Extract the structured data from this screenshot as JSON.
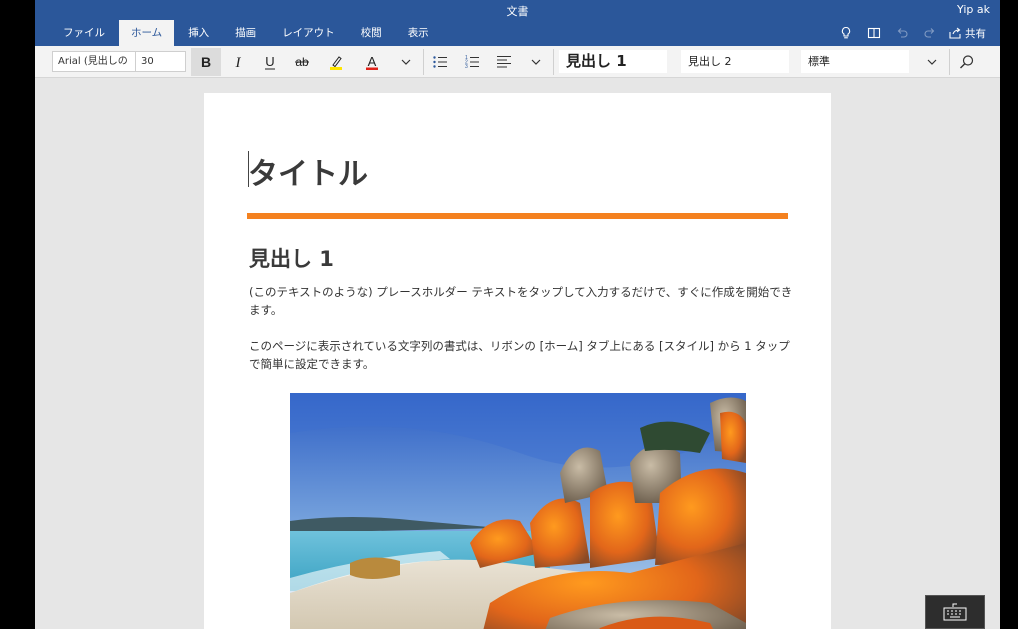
{
  "window": {
    "title": "文書",
    "user": "Yip ak"
  },
  "tabs": [
    {
      "label": "ファイル"
    },
    {
      "label": "ホーム",
      "active": true
    },
    {
      "label": "挿入"
    },
    {
      "label": "描画"
    },
    {
      "label": "レイアウト"
    },
    {
      "label": "校閲"
    },
    {
      "label": "表示"
    }
  ],
  "title_actions": {
    "share_label": "共有",
    "icons": [
      "lightbulb-icon",
      "book-icon",
      "undo-icon",
      "redo-icon",
      "share-icon"
    ]
  },
  "toolbar": {
    "font_name": "Arial (見出しの",
    "font_size": "30",
    "bold_icon": "bold-icon",
    "italic_icon": "italic-icon",
    "underline_icon": "underline-icon",
    "strike_icon": "strikethrough-icon",
    "highlight_icon": "highlighter-icon",
    "font_color_icon": "font-color-icon",
    "highlight_color": "#ffe600",
    "font_color": "#e0231a",
    "styles": [
      "見出し 1",
      "見出し 2",
      "標準"
    ]
  },
  "document": {
    "title": "タイトル",
    "title_rule_color": "#f4811f",
    "heading1": "見出し 1",
    "para1": "(このテキストのような) プレースホルダー テキストをタップして入力するだけで、すぐに作成を開始できます。",
    "para2": "このページに表示されている文字列の書式は、リボンの [ホーム] タブ上にある [スタイル] から 1 タップで簡単に設定できます。"
  },
  "colors": {
    "ribbon": "#2b579a",
    "toolbar": "#f3f3f3",
    "canvas": "#e6e6e6"
  }
}
